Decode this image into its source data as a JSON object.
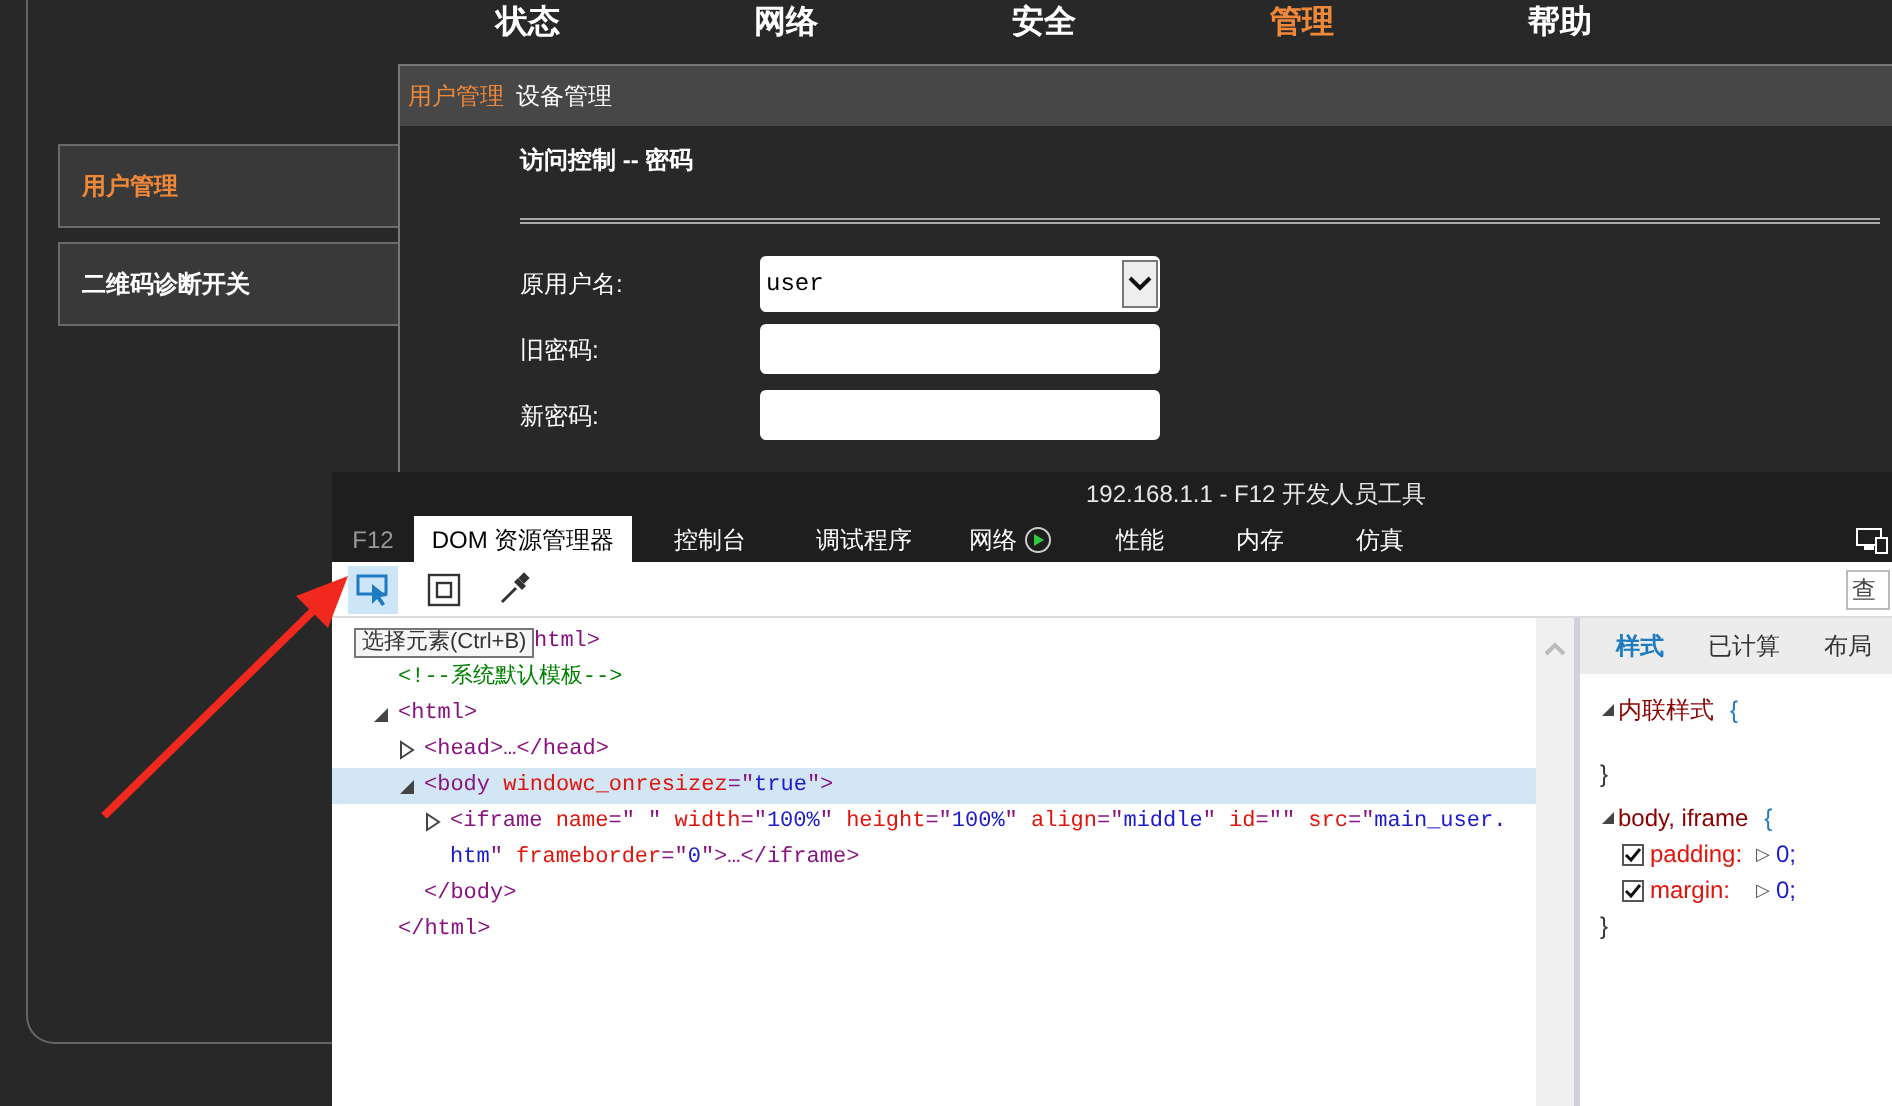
{
  "top_nav": [
    {
      "label": "状态",
      "selected": false
    },
    {
      "label": "网络",
      "selected": false
    },
    {
      "label": "安全",
      "selected": false
    },
    {
      "label": "管理",
      "selected": true
    },
    {
      "label": "帮助",
      "selected": false
    }
  ],
  "sidebar": [
    {
      "label": "用户管理",
      "selected": true
    },
    {
      "label": "二维码诊断开关",
      "selected": false
    }
  ],
  "panel": {
    "breadcrumb": [
      {
        "label": "用户管理",
        "selected": true
      },
      {
        "label": "设备管理",
        "selected": false
      }
    ],
    "heading": "访问控制 -- 密码",
    "fields": [
      {
        "label": "原用户名:",
        "kind": "select",
        "value": "user"
      },
      {
        "label": "旧密码:",
        "kind": "password"
      },
      {
        "label": "新密码:",
        "kind": "password"
      }
    ]
  },
  "devtools": {
    "title": "192.168.1.1 - F12 开发人员工具",
    "tabs": [
      {
        "label": "F12",
        "kind": "brand",
        "selected": false
      },
      {
        "label": "DOM 资源管理器",
        "kind": "plain",
        "selected": true
      },
      {
        "label": "控制台",
        "kind": "plain",
        "selected": false
      },
      {
        "label": "调试程序",
        "kind": "plain",
        "selected": false
      },
      {
        "label": "网络",
        "kind": "recording",
        "selected": false
      },
      {
        "label": "性能",
        "kind": "plain",
        "selected": false
      },
      {
        "label": "内存",
        "kind": "plain",
        "selected": false
      },
      {
        "label": "仿真",
        "kind": "plain",
        "selected": false
      }
    ],
    "tools": [
      {
        "kind": "select",
        "selected": true
      },
      {
        "kind": "box",
        "selected": false
      },
      {
        "kind": "picker",
        "selected": false
      }
    ],
    "tooltip": "选择元素(Ctrl+B)",
    "search": {
      "placeholder": "查"
    },
    "dom_tree": [
      {
        "parts": [
          {
            "kind": "tag",
            "text": "html>"
          }
        ],
        "partial": true,
        "selected": false
      },
      {
        "parts": [
          {
            "kind": "comment",
            "text": "<!--系统默认模板-->"
          }
        ],
        "selected": false
      },
      {
        "parts": [
          {
            "kind": "tag",
            "text": "<html>"
          }
        ],
        "expanded": true,
        "selected": false,
        "closing": "</html>",
        "children": [
          {
            "parts": [
              {
                "kind": "tag",
                "text": "<head>…</head>"
              }
            ],
            "expanded": false,
            "selected": false
          },
          {
            "parts": [
              {
                "kind": "tag",
                "text": "<body"
              },
              {
                "kind": "attr",
                "text": " windowc_onresizez"
              },
              {
                "kind": "tag",
                "text": "=\""
              },
              {
                "kind": "value",
                "text": "true"
              },
              {
                "kind": "tag",
                "text": "\">"
              }
            ],
            "expanded": true,
            "selected": true,
            "closing": "</body>",
            "children": [
              {
                "parts": [
                  {
                    "kind": "tag",
                    "text": "<iframe"
                  },
                  {
                    "kind": "attr",
                    "text": " name"
                  },
                  {
                    "kind": "tag",
                    "text": "=\" \""
                  },
                  {
                    "kind": "attr",
                    "text": " width"
                  },
                  {
                    "kind": "tag",
                    "text": "=\""
                  },
                  {
                    "kind": "value",
                    "text": "100%"
                  },
                  {
                    "kind": "tag",
                    "text": "\""
                  },
                  {
                    "kind": "attr",
                    "text": " height"
                  },
                  {
                    "kind": "tag",
                    "text": "=\""
                  },
                  {
                    "kind": "value",
                    "text": "100%"
                  },
                  {
                    "kind": "tag",
                    "text": "\""
                  },
                  {
                    "kind": "attr",
                    "text": " align"
                  },
                  {
                    "kind": "tag",
                    "text": "=\""
                  },
                  {
                    "kind": "value",
                    "text": "middle"
                  },
                  {
                    "kind": "tag",
                    "text": "\""
                  },
                  {
                    "kind": "attr",
                    "text": " id"
                  },
                  {
                    "kind": "tag",
                    "text": "=\"\""
                  },
                  {
                    "kind": "attr",
                    "text": " src"
                  },
                  {
                    "kind": "tag",
                    "text": "=\""
                  },
                  {
                    "kind": "value",
                    "text": "main_user.htm"
                  },
                  {
                    "kind": "tag",
                    "text": "\""
                  },
                  {
                    "kind": "attr",
                    "text": " frameborder"
                  },
                  {
                    "kind": "tag",
                    "text": "=\""
                  },
                  {
                    "kind": "value",
                    "text": "0"
                  },
                  {
                    "kind": "tag",
                    "text": "\">…</iframe>"
                  }
                ],
                "expanded": false,
                "selected": false
              }
            ]
          }
        ]
      }
    ],
    "styles_tabs": [
      {
        "label": "样式",
        "selected": true
      },
      {
        "label": "已计算",
        "selected": false
      },
      {
        "label": "布局",
        "selected": false
      }
    ],
    "style_rules": [
      {
        "selector": "内联样式",
        "open": "{",
        "close": "}",
        "expanded": true
      },
      {
        "selector": "body, iframe",
        "open": "{",
        "close": "}",
        "expanded": true,
        "declarations": [
          {
            "property": "padding:",
            "expander": "▷",
            "value": "0;",
            "checked": true
          },
          {
            "property": "margin:",
            "expander": "▷",
            "value": "0;",
            "checked": true
          }
        ]
      }
    ]
  }
}
